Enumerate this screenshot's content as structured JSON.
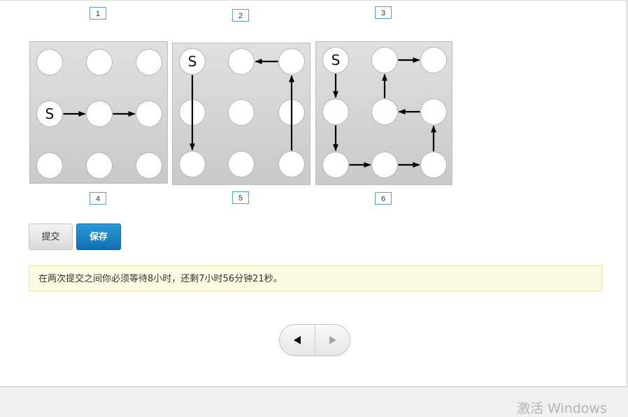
{
  "option_labels": [
    "1",
    "2",
    "3",
    "4",
    "5",
    "6"
  ],
  "puzzles": [
    {
      "id": "puzzle-1",
      "start": [
        1,
        0
      ],
      "arrows": [
        [
          [
            1,
            0
          ],
          [
            1,
            1
          ]
        ],
        [
          [
            1,
            1
          ],
          [
            1,
            2
          ]
        ]
      ]
    },
    {
      "id": "puzzle-2",
      "start": [
        0,
        0
      ],
      "arrows": [
        [
          [
            0,
            0
          ],
          [
            2,
            0
          ]
        ],
        [
          [
            2,
            2
          ],
          [
            0,
            2
          ]
        ],
        [
          [
            0,
            2
          ],
          [
            0,
            1
          ]
        ]
      ]
    },
    {
      "id": "puzzle-3",
      "start": [
        0,
        0
      ],
      "arrows": [
        [
          [
            0,
            0
          ],
          [
            1,
            0
          ]
        ],
        [
          [
            1,
            0
          ],
          [
            2,
            0
          ]
        ],
        [
          [
            2,
            0
          ],
          [
            2,
            1
          ]
        ],
        [
          [
            2,
            1
          ],
          [
            2,
            2
          ]
        ],
        [
          [
            2,
            2
          ],
          [
            1,
            2
          ]
        ],
        [
          [
            1,
            2
          ],
          [
            1,
            1
          ]
        ],
        [
          [
            1,
            1
          ],
          [
            0,
            1
          ]
        ],
        [
          [
            0,
            1
          ],
          [
            0,
            2
          ]
        ]
      ]
    }
  ],
  "start_label": "S",
  "buttons": {
    "submit_label": "提交",
    "save_label": "保存"
  },
  "notice": {
    "text": "在两次提交之间你必须等待8小时，还剩7小时56分钟21秒。"
  },
  "watermark": "激活 Windows",
  "colors": {
    "primary": "#1a86c8",
    "notice_bg": "#fdfae4",
    "puzzle_bg": "#d0d0d0"
  }
}
